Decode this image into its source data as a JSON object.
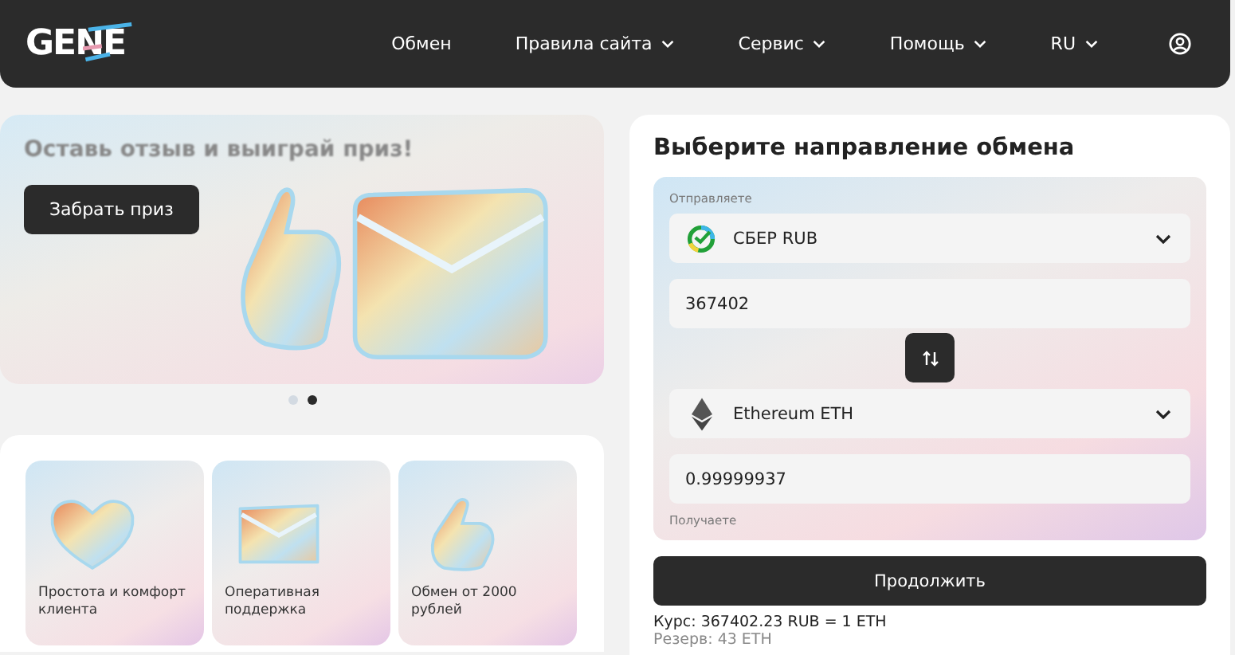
{
  "header": {
    "logo": "GENE",
    "nav": [
      {
        "label": "Обмен",
        "dropdown": false
      },
      {
        "label": "Правила сайта",
        "dropdown": true
      },
      {
        "label": "Сервис",
        "dropdown": true
      },
      {
        "label": "Помощь",
        "dropdown": true
      },
      {
        "label": "RU",
        "dropdown": true
      }
    ]
  },
  "banner": {
    "title": "Оставь отзыв и выиграй приз!",
    "button": "Забрать приз",
    "dots": [
      {
        "selected": false
      },
      {
        "selected": true
      }
    ]
  },
  "features": [
    {
      "kind": "heart",
      "text": "Простота и комфорт клиента"
    },
    {
      "kind": "envelope",
      "text": "Оперативная поддержка"
    },
    {
      "kind": "thumb",
      "text": "Обмен от 2000 рублей"
    }
  ],
  "exchange": {
    "title": "Выберите направление обмена",
    "send_label": "Отправляете",
    "send_currency": {
      "kind": "sber",
      "name": "СБЕР RUB"
    },
    "send_amount": "367402",
    "receive_currency": {
      "kind": "eth",
      "name": "Ethereum ETH"
    },
    "receive_amount": "0.99999937",
    "receive_label": "Получаете",
    "button": "Продолжить",
    "rate": "Курс: 367402.23 RUB = 1 ETH",
    "reserve": "Резерв: 43 ETH"
  }
}
